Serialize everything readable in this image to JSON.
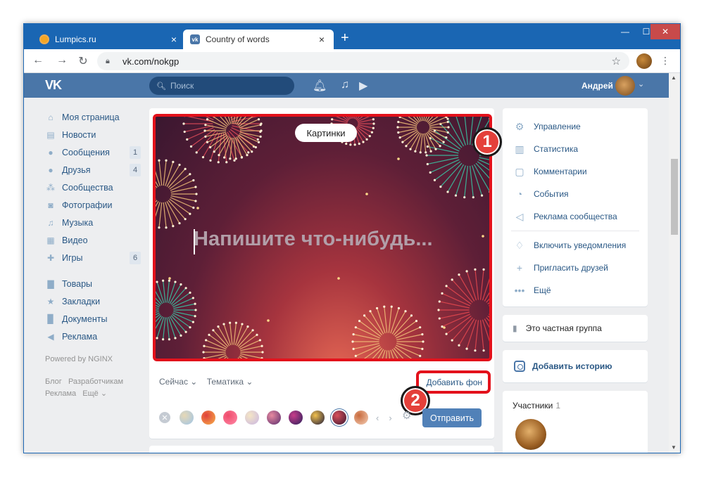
{
  "browser": {
    "tabs": [
      {
        "title": "Lumpics.ru",
        "close": "×"
      },
      {
        "title": "Country of words",
        "close": "×"
      }
    ],
    "new_tab": "+",
    "window_controls": {
      "minimize": "—",
      "maximize": "☐",
      "close": "✕"
    },
    "url": "vk.com/nokgp",
    "nav": {
      "back": "←",
      "forward": "→",
      "reload": "↻"
    },
    "star": "☆",
    "menu": "⋮"
  },
  "vk_header": {
    "logo": "VK",
    "search_placeholder": "Поиск",
    "user_name": "Андрей",
    "chevron": "⌄"
  },
  "left_menu": {
    "items": [
      {
        "label": "Моя страница",
        "icon": "home-icon",
        "badge": ""
      },
      {
        "label": "Новости",
        "icon": "news-icon",
        "badge": ""
      },
      {
        "label": "Сообщения",
        "icon": "messages-icon",
        "badge": "1"
      },
      {
        "label": "Друзья",
        "icon": "friends-icon",
        "badge": "4"
      },
      {
        "label": "Сообщества",
        "icon": "communities-icon",
        "badge": ""
      },
      {
        "label": "Фотографии",
        "icon": "photos-icon",
        "badge": ""
      },
      {
        "label": "Музыка",
        "icon": "music-icon",
        "badge": ""
      },
      {
        "label": "Видео",
        "icon": "video-icon",
        "badge": ""
      },
      {
        "label": "Игры",
        "icon": "games-icon",
        "badge": "6"
      },
      {
        "label": "Товары",
        "icon": "goods-icon",
        "badge": ""
      },
      {
        "label": "Закладки",
        "icon": "bookmarks-icon",
        "badge": ""
      },
      {
        "label": "Документы",
        "icon": "documents-icon",
        "badge": ""
      },
      {
        "label": "Реклама",
        "icon": "ads-icon",
        "badge": ""
      }
    ],
    "powered": "Powered by NGINX",
    "footer_links": [
      "Блог",
      "Разработчикам",
      "Реклама",
      "Ещё ⌄"
    ]
  },
  "post_editor": {
    "pictures_button": "Картинки",
    "placeholder": "Напишите что-нибудь...",
    "options": [
      "Сейчас ⌄",
      "Тематика ⌄"
    ],
    "add_background": "Добавить фон",
    "send": "Отправить",
    "backgrounds": [
      {
        "colors": [
          "#9fc5e8",
          "#e7d8b5"
        ]
      },
      {
        "colors": [
          "#f6b24a",
          "#e0413b"
        ]
      },
      {
        "colors": [
          "#ff8aa8",
          "#ef4b6b"
        ]
      },
      {
        "colors": [
          "#c9b6e3",
          "#f5e6c5"
        ]
      },
      {
        "colors": [
          "#5a2d6e",
          "#e88aa0"
        ]
      },
      {
        "colors": [
          "#2a1f5c",
          "#c93d8a"
        ]
      },
      {
        "colors": [
          "#1d1a3a",
          "#f2c14e"
        ]
      },
      {
        "colors": [
          "#3a1730",
          "#d9505c"
        ]
      },
      {
        "colors": [
          "#f5d0b8",
          "#c86a3c"
        ]
      }
    ]
  },
  "annotations": {
    "marker1": "1",
    "marker2": "2"
  },
  "right_menu": {
    "items": [
      {
        "label": "Управление",
        "icon": "gear-icon"
      },
      {
        "label": "Статистика",
        "icon": "stats-icon"
      },
      {
        "label": "Комментарии",
        "icon": "comments-icon"
      },
      {
        "label": "События",
        "icon": "events-icon"
      },
      {
        "label": "Реклама сообщества",
        "icon": "megaphone-icon"
      }
    ],
    "items2": [
      {
        "label": "Включить уведомления",
        "icon": "bell-icon"
      },
      {
        "label": "Пригласить друзей",
        "icon": "invite-icon"
      },
      {
        "label": "Ещё",
        "icon": "more-icon"
      }
    ],
    "private_group": "Это частная группа",
    "add_story": "Добавить историю",
    "members_title": "Участники",
    "members_count": "1"
  },
  "colors": {
    "vk_blue": "#4a76a8",
    "highlight_red": "#e3111b",
    "browser_frame": "#1a66b3"
  }
}
